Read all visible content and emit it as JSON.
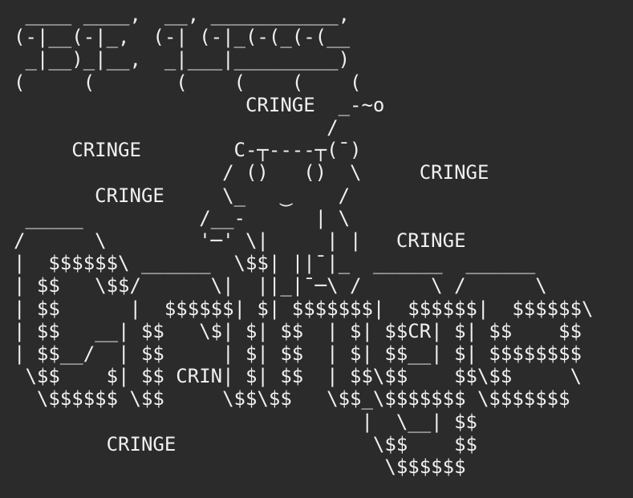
{
  "colors": {
    "background": "#2b2b2b",
    "foreground": "#f0f0f0"
  },
  "art": [
    " ____ ____,  __, ___________,",
    "(-|__(-|_,  (-| (-|_(-(_(-(__",
    " _|__)_|__,  _|___|_________)",
    "(     (       (    (    (    (",
    "                    CRINGE  _-~o",
    "                           /",
    "     CRINGE        C-┬----┬(ˉ)",
    "                  / ()   ()  \\     CRINGE",
    "       CRINGE     \\_   ‿    /",
    " _____          /__-      | \\",
    "/      \\        '─' \\|     | |   CRINGE",
    "|  $$$$$$\\ ______  \\$$| ||ˉ|_  ______  ______",
    "| $$   \\$$/      \\|  ||_|ˉ─\\ /      \\ /      \\",
    "| $$      |  $$$$$$| $| $$$$$$$|  $$$$$$|  $$$$$$\\",
    "| $$   __| $$   \\$| $| $$  | $| $$CR| $| $$    $$",
    "| $$__/  | $$     | $| $$  | $| $$__| $| $$$$$$$$",
    " \\$$    $| $$ CRIN| $| $$  | $$\\$$    $$\\$$     \\",
    "  \\$$$$$$ \\$$     \\$$\\$$   \\$$_\\$$$$$$$ \\$$$$$$$",
    "                              |  \\__| $$",
    "        CRINGE                 \\$$    $$",
    "                                \\$$$$$$"
  ]
}
